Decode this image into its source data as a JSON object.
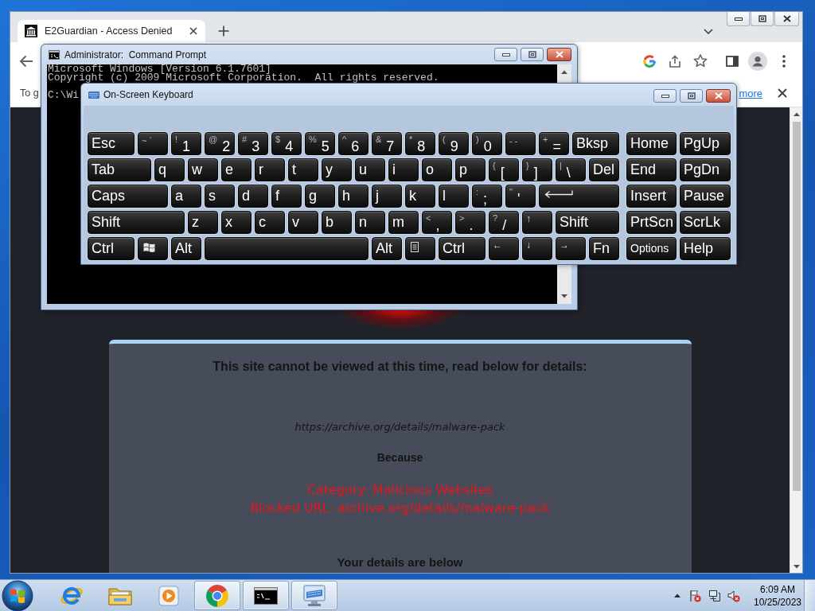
{
  "browser": {
    "tabs": [
      {
        "title": "E2Guardian - Access Denied",
        "selected": true
      }
    ],
    "infobar": {
      "text": "To g",
      "link": "more"
    },
    "page": {
      "heading": "This site cannot be viewed at this time, read below for details:",
      "url": "https://archive.org/details/malware-pack",
      "because": "Because",
      "reasons": [
        "Category: Malicious Websites",
        "Blocked URL: archive.org/details/malware-pack"
      ],
      "details_heading": "Your details are below"
    }
  },
  "console": {
    "title": "Administrator:  Command Prompt",
    "lines": [
      "Microsoft Windows [Version 6.1.7601]",
      "Copyright (c) 2009 Microsoft Corporation.  All rights reserved."
    ],
    "prompt": "C:\\Wi"
  },
  "keyboard": {
    "title": "On-Screen Keyboard",
    "rows": [
      {
        "keys": [
          {
            "kind": "label",
            "label": "Esc"
          },
          {
            "kind": "pair",
            "label": "~ `"
          },
          {
            "kind": "dual",
            "shift": "!",
            "label": "1"
          },
          {
            "kind": "dual",
            "shift": "@",
            "label": "2"
          },
          {
            "kind": "dual",
            "shift": "#",
            "label": "3"
          },
          {
            "kind": "dual",
            "shift": "$",
            "label": "4"
          },
          {
            "kind": "dual",
            "shift": "%",
            "label": "5"
          },
          {
            "kind": "dual",
            "shift": "^",
            "label": "6"
          },
          {
            "kind": "dual",
            "shift": "&",
            "label": "7"
          },
          {
            "kind": "dual",
            "shift": "*",
            "label": "8"
          },
          {
            "kind": "dual",
            "shift": "(",
            "label": "9"
          },
          {
            "kind": "dual",
            "shift": ")",
            "label": "0"
          },
          {
            "kind": "pair",
            "label": "- -"
          },
          {
            "kind": "dual",
            "shift": "+",
            "label": "="
          },
          {
            "kind": "label",
            "label": "Bksp"
          }
        ],
        "nav": [
          {
            "kind": "label",
            "label": "Home"
          },
          {
            "kind": "label",
            "label": "PgUp"
          }
        ]
      },
      {
        "keys": [
          {
            "kind": "label",
            "label": "Tab"
          },
          {
            "kind": "label",
            "label": "q"
          },
          {
            "kind": "label",
            "label": "w"
          },
          {
            "kind": "label",
            "label": "e"
          },
          {
            "kind": "label",
            "label": "r"
          },
          {
            "kind": "label",
            "label": "t"
          },
          {
            "kind": "label",
            "label": "y"
          },
          {
            "kind": "label",
            "label": "u"
          },
          {
            "kind": "label",
            "label": "i"
          },
          {
            "kind": "label",
            "label": "o"
          },
          {
            "kind": "label",
            "label": "p"
          },
          {
            "kind": "dual",
            "shift": "{",
            "label": "["
          },
          {
            "kind": "dual",
            "shift": "}",
            "label": "]"
          },
          {
            "kind": "dual",
            "shift": "|",
            "label": "\\"
          },
          {
            "kind": "label",
            "label": "Del"
          }
        ],
        "nav": [
          {
            "kind": "label",
            "label": "End"
          },
          {
            "kind": "label",
            "label": "PgDn"
          }
        ]
      },
      {
        "keys": [
          {
            "kind": "label",
            "label": "Caps"
          },
          {
            "kind": "label",
            "label": "a"
          },
          {
            "kind": "label",
            "label": "s"
          },
          {
            "kind": "label",
            "label": "d"
          },
          {
            "kind": "label",
            "label": "f"
          },
          {
            "kind": "label",
            "label": "g"
          },
          {
            "kind": "label",
            "label": "h"
          },
          {
            "kind": "label",
            "label": "j"
          },
          {
            "kind": "label",
            "label": "k"
          },
          {
            "kind": "label",
            "label": "l"
          },
          {
            "kind": "dual",
            "shift": ":",
            "label": ";"
          },
          {
            "kind": "dual",
            "shift": "\"",
            "label": "'"
          },
          {
            "kind": "enter"
          }
        ],
        "nav": [
          {
            "kind": "label",
            "label": "Insert"
          },
          {
            "kind": "label",
            "label": "Pause"
          }
        ]
      },
      {
        "keys": [
          {
            "kind": "label",
            "label": "Shift"
          },
          {
            "kind": "label",
            "label": "z"
          },
          {
            "kind": "label",
            "label": "x"
          },
          {
            "kind": "label",
            "label": "c"
          },
          {
            "kind": "label",
            "label": "v"
          },
          {
            "kind": "label",
            "label": "b"
          },
          {
            "kind": "label",
            "label": "n"
          },
          {
            "kind": "label",
            "label": "m"
          },
          {
            "kind": "dual",
            "shift": "<",
            "label": ","
          },
          {
            "kind": "dual",
            "shift": ">",
            "label": "."
          },
          {
            "kind": "dual",
            "shift": "?",
            "label": "/"
          },
          {
            "kind": "arrow",
            "label": "↑"
          },
          {
            "kind": "label",
            "label": "Shift"
          }
        ],
        "nav": [
          {
            "kind": "label",
            "label": "PrtScn"
          },
          {
            "kind": "label",
            "label": "ScrLk"
          }
        ]
      },
      {
        "keys": [
          {
            "kind": "label",
            "label": "Ctrl"
          },
          {
            "kind": "logo"
          },
          {
            "kind": "label",
            "label": "Alt"
          },
          {
            "kind": "space"
          },
          {
            "kind": "label",
            "label": "Alt"
          },
          {
            "kind": "menu"
          },
          {
            "kind": "label",
            "label": "Ctrl"
          },
          {
            "kind": "arrow",
            "label": "←"
          },
          {
            "kind": "arrow",
            "label": "↓"
          },
          {
            "kind": "arrow",
            "label": "→"
          },
          {
            "kind": "label",
            "label": "Fn"
          }
        ],
        "nav": [
          {
            "kind": "compact",
            "label": "Options"
          },
          {
            "kind": "label",
            "label": "Help"
          }
        ]
      }
    ]
  },
  "taskbar": {
    "items": [
      {
        "kind": "ie",
        "open": false
      },
      {
        "kind": "folder",
        "open": false
      },
      {
        "kind": "media",
        "open": false
      },
      {
        "kind": "chrome",
        "open": true
      },
      {
        "kind": "console",
        "open": true
      },
      {
        "kind": "osk",
        "open": true
      }
    ],
    "clock": {
      "time": "6:09 AM",
      "date": "10/25/2023"
    }
  }
}
